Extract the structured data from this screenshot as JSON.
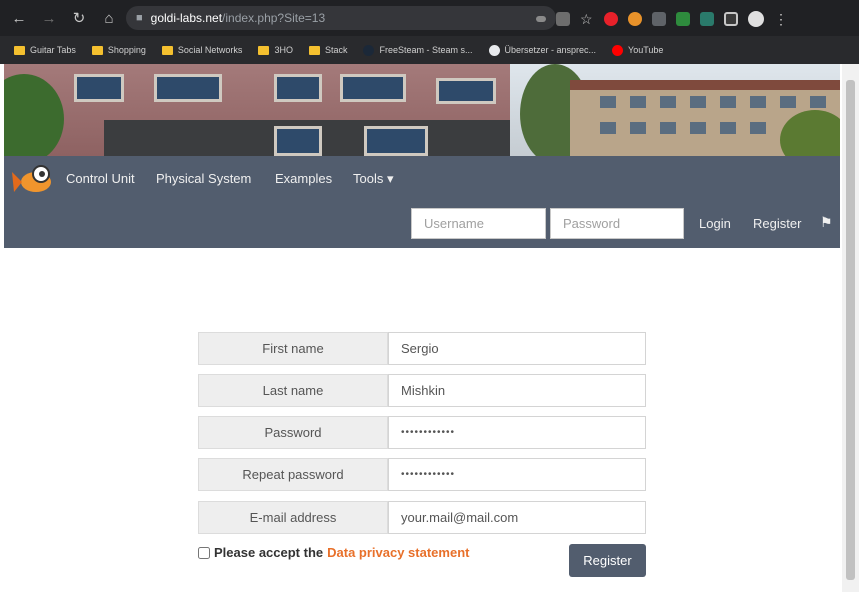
{
  "browser": {
    "url_host": "goldi-labs.net",
    "url_path": "/index.php?Site=13",
    "bookmarks": [
      {
        "label": "Guitar Tabs",
        "icon": "folder-icon"
      },
      {
        "label": "Shopping",
        "icon": "folder-icon"
      },
      {
        "label": "Social Networks",
        "icon": "folder-icon"
      },
      {
        "label": "3HO",
        "icon": "folder-icon"
      },
      {
        "label": "Stack",
        "icon": "folder-icon"
      },
      {
        "label": "FreeSteam - Steam s...",
        "icon": "steam-icon"
      },
      {
        "label": "Übersetzer - ansprec...",
        "icon": "globe-icon"
      },
      {
        "label": "YouTube",
        "icon": "youtube-icon"
      }
    ]
  },
  "nav": {
    "links": [
      "Control Unit",
      "Physical System",
      "Examples",
      "Tools ▾"
    ],
    "username_placeholder": "Username",
    "password_placeholder": "Password",
    "login": "Login",
    "register": "Register"
  },
  "form": {
    "rows": [
      {
        "label": "First name",
        "value": "Sergio"
      },
      {
        "label": "Last name",
        "value": "Mishkin"
      },
      {
        "label": "Password",
        "value": "••••••••••••"
      },
      {
        "label": "Repeat password",
        "value": "••••••••••••"
      },
      {
        "label": "E-mail address",
        "value": "your.mail@mail.com"
      }
    ],
    "privacy_text": "Please accept the",
    "privacy_link": "Data privacy statement",
    "submit": "Register"
  },
  "colors": {
    "navbar": "#525d6e",
    "accent": "#e8702a"
  }
}
